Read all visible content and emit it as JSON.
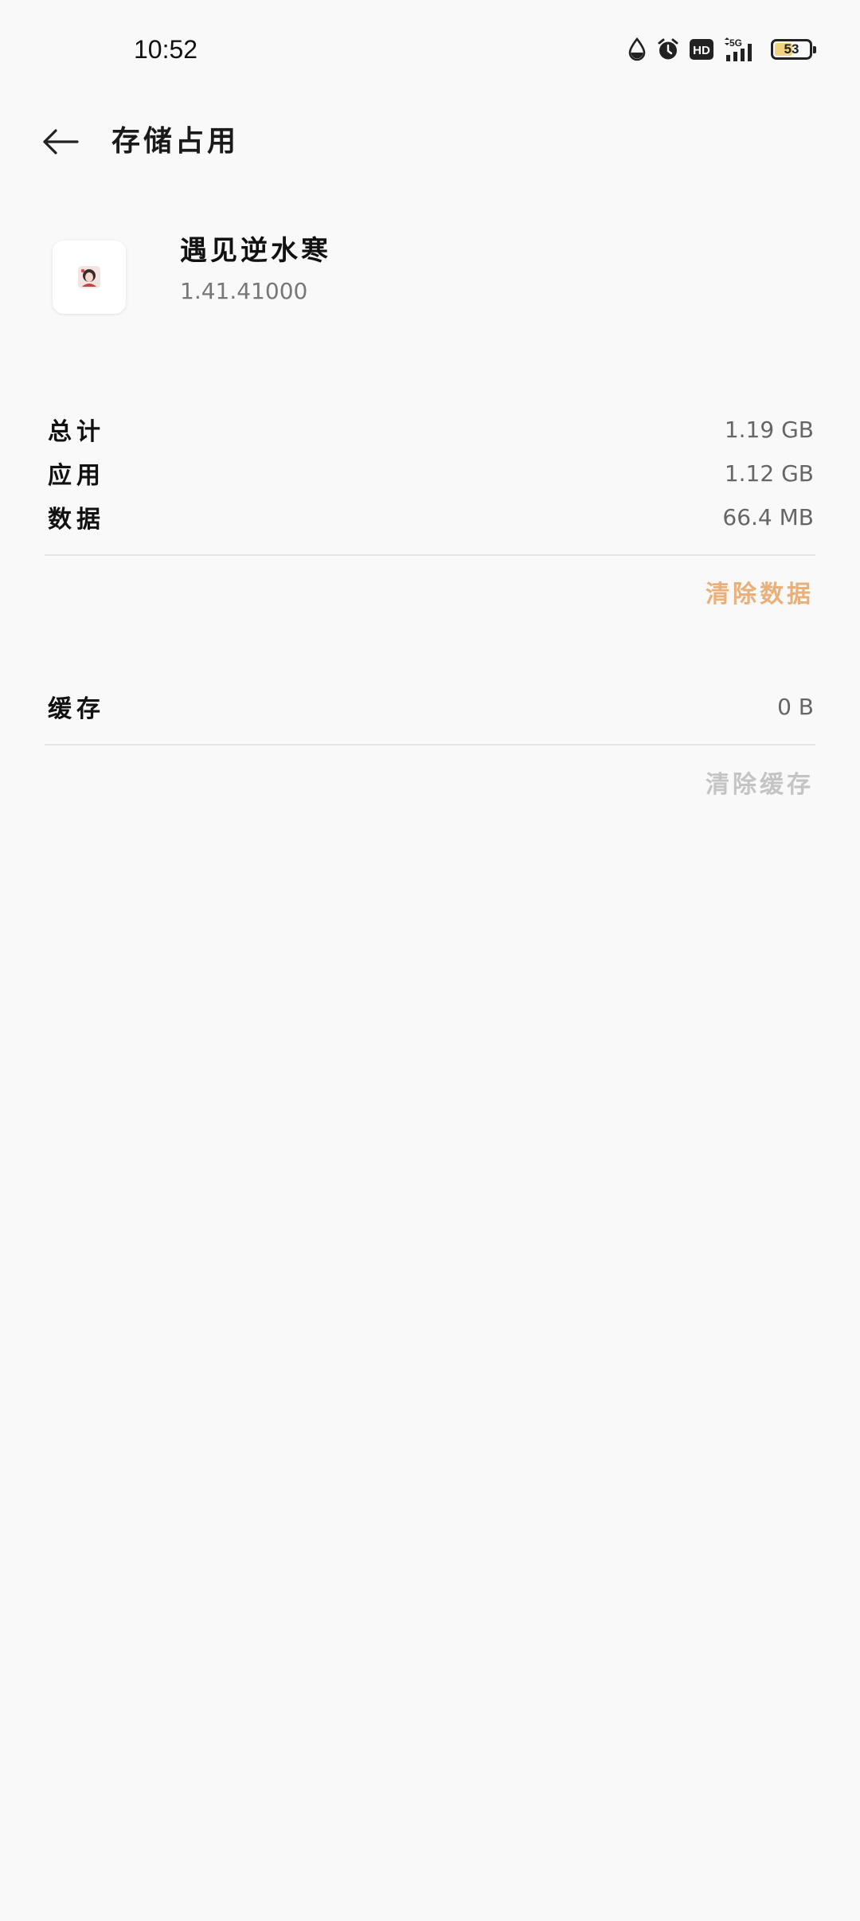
{
  "status_bar": {
    "time": "10:52",
    "network_label": "5G",
    "hd_label": "HD",
    "battery_level": 53,
    "battery_text": "53",
    "battery_color": "#f2d27a"
  },
  "header": {
    "title": "存储占用",
    "back_icon": "arrow-left-icon"
  },
  "app": {
    "name": "遇见逆水寒",
    "version": "1.41.41000",
    "icon": "app-icon"
  },
  "storage": {
    "total_label": "总计",
    "total_value": "1.19 GB",
    "app_label": "应用",
    "app_value": "1.12 GB",
    "data_label": "数据",
    "data_value": "66.4 MB",
    "clear_data_label": "清除数据",
    "cache_label": "缓存",
    "cache_value": "0 B",
    "clear_cache_label": "清除缓存"
  },
  "colors": {
    "accent": "#e8b07a",
    "disabled": "#c4c4c4",
    "background": "#f9f9f9"
  }
}
